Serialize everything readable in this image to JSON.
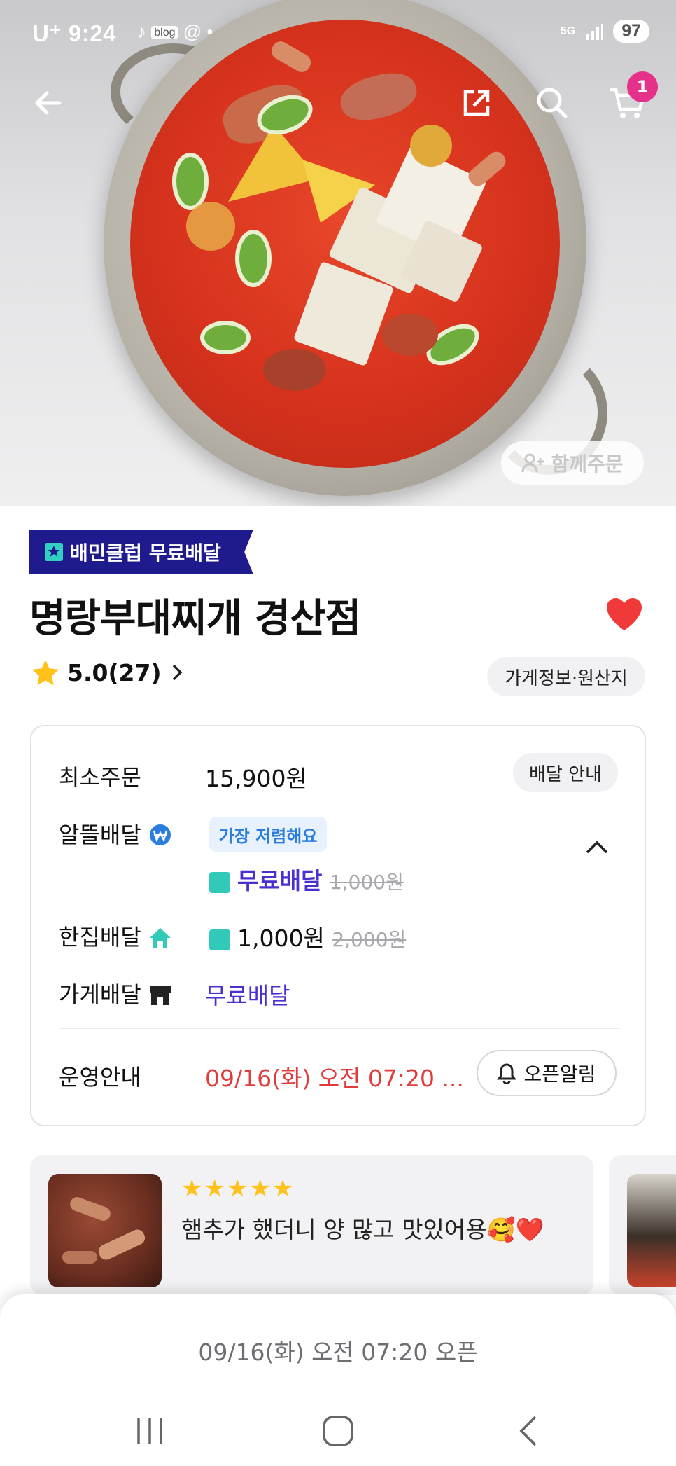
{
  "status_bar": {
    "carrier": "U⁺",
    "time": "9:24",
    "notification_icons": [
      "tiktok-icon",
      "blog-icon",
      "threads-icon",
      "dot"
    ],
    "network": "5G",
    "battery": "97"
  },
  "header": {
    "back_icon": "arrow-left-icon",
    "share_icon": "share-icon",
    "search_icon": "search-icon",
    "cart_icon": "cart-icon",
    "cart_count": "1",
    "together_order": "함께주문"
  },
  "store": {
    "club_badge": "배민클럽 무료배달",
    "name": "명랑부대찌개 경산점",
    "rating": "5.0(27)",
    "store_info_button": "가게정보·원산지",
    "favorite": true
  },
  "delivery": {
    "min_order_label": "최소주문",
    "min_order_value": "15,900원",
    "delivery_guide_button": "배달 안내",
    "saver_label": "알뜰배달",
    "saver_tag": "가장 저렴해요",
    "saver_price": "무료배달",
    "saver_old_price": "1,000원",
    "single_label": "한집배달",
    "single_price": "1,000원",
    "single_old_price": "2,000원",
    "store_label": "가게배달",
    "store_price": "무료배달",
    "hours_label": "운영안내",
    "hours_value": "09/16(화) 오전 07:20 ...",
    "open_alarm_button": "오픈알림"
  },
  "reviews": [
    {
      "stars": "★★★★★",
      "text": "햄추가 했더니 양 많고 맛있어용🥰❤️"
    }
  ],
  "bottom": {
    "open_notice": "09/16(화) 오전 07:20 오픈"
  },
  "colors": {
    "club_bg": "#1f1b8f",
    "accent_purple": "#4b2fd1",
    "cart_badge": "#e6318a",
    "heart": "#f03a3a",
    "hours_red": "#e03c3c",
    "teal": "#31c9b8"
  }
}
